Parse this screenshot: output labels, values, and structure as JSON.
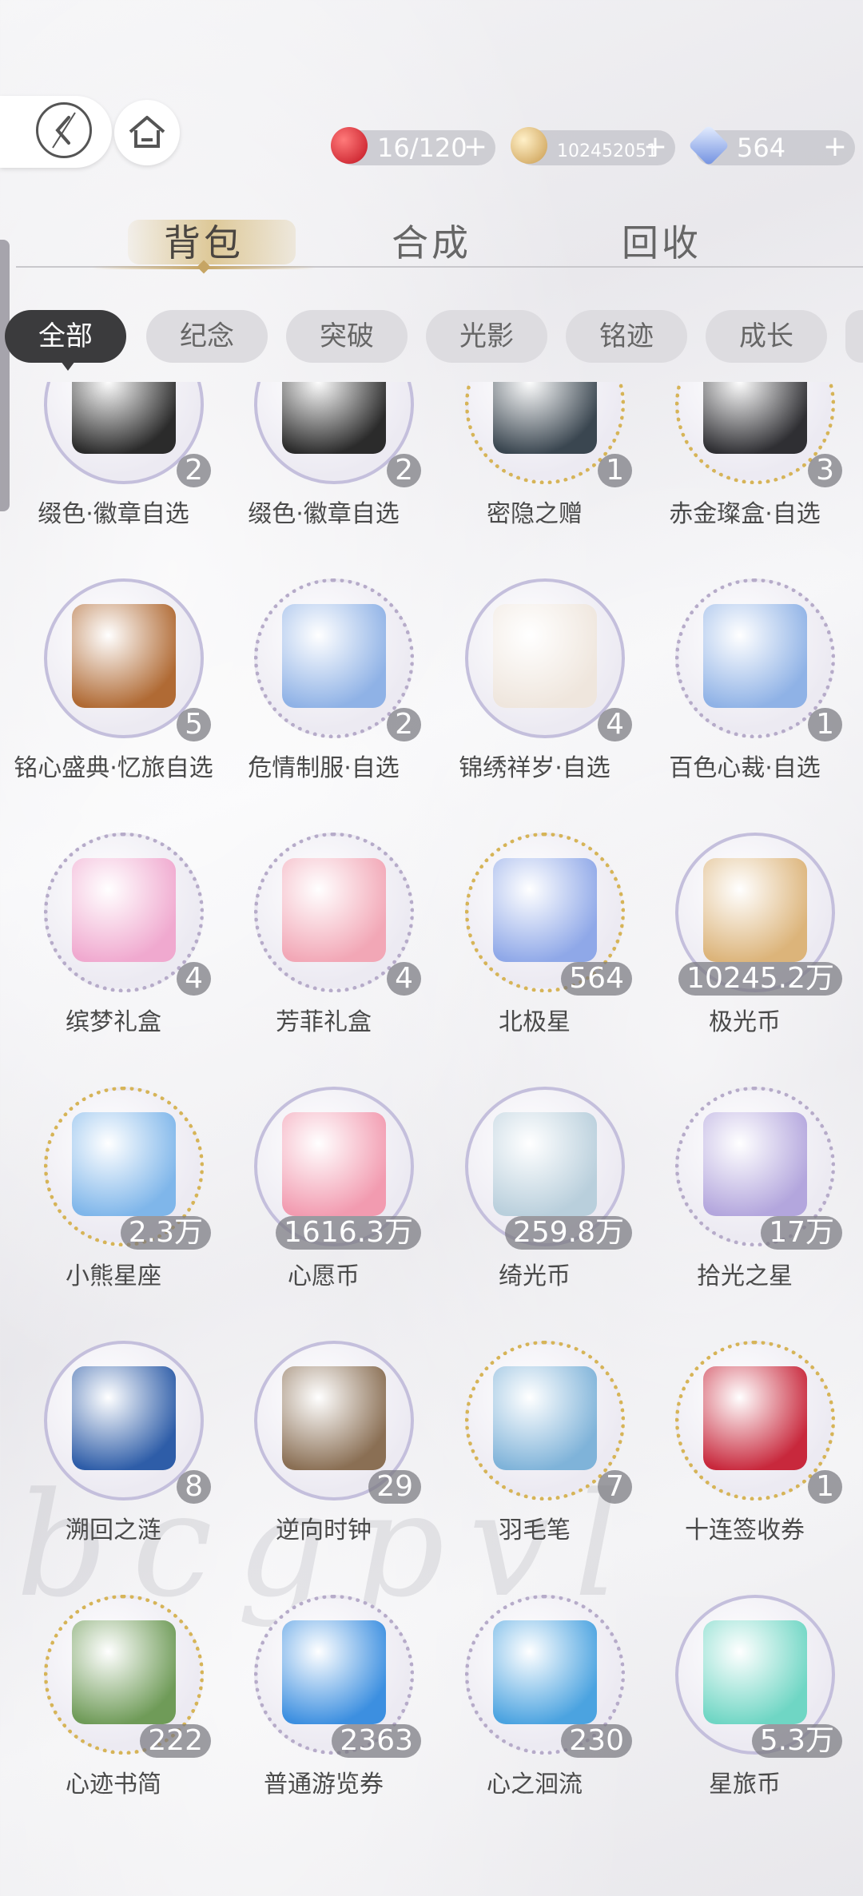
{
  "resources": [
    {
      "icon": "apple-icon",
      "value": "16/120",
      "color": "#d9262b"
    },
    {
      "icon": "coin-icon",
      "value": "102452051",
      "color": "#d8b26a"
    },
    {
      "icon": "star-crystal-icon",
      "value": "564",
      "color": "#7b8fd6"
    }
  ],
  "tabs": [
    "背包",
    "合成",
    "回收"
  ],
  "categories": [
    "全部",
    "纪念",
    "突破",
    "光影",
    "铭迹",
    "成长"
  ],
  "items": [
    {
      "name": "缀色·徽章自选",
      "count": "2",
      "border": "plain",
      "color": "#2b2b2b"
    },
    {
      "name": "缀色·徽章自选",
      "count": "2",
      "border": "plain",
      "color": "#2b2b2b"
    },
    {
      "name": "密隐之赠",
      "count": "1",
      "border": "gold",
      "color": "#3a4650"
    },
    {
      "name": "赤金璨盒·自选",
      "count": "3",
      "border": "gold",
      "color": "#2f2f33"
    },
    {
      "name": "铭心盛典·忆旅自选",
      "count": "5",
      "border": "plain",
      "color": "#b06a34"
    },
    {
      "name": "危情制服·自选",
      "count": "2",
      "border": "glitter",
      "color": "#8fb2e6"
    },
    {
      "name": "锦绣祥岁·自选",
      "count": "4",
      "border": "plain",
      "color": "#efe6dd"
    },
    {
      "name": "百色心裁·自选",
      "count": "1",
      "border": "glitter",
      "color": "#8fb2e6"
    },
    {
      "name": "缤梦礼盒",
      "count": "4",
      "border": "glitter",
      "color": "#f0a9cf"
    },
    {
      "name": "芳菲礼盒",
      "count": "4",
      "border": "glitter",
      "color": "#f2a7b6"
    },
    {
      "name": "北极星",
      "count": "564",
      "border": "gold",
      "color": "#8fa8e8"
    },
    {
      "name": "极光币",
      "count": "10245.2万",
      "border": "plain",
      "color": "#dcb47a"
    },
    {
      "name": "小熊星座",
      "count": "2.3万",
      "border": "gold",
      "color": "#7fb6ea"
    },
    {
      "name": "心愿币",
      "count": "1616.3万",
      "border": "plain",
      "color": "#f29bb0"
    },
    {
      "name": "绮光币",
      "count": "259.8万",
      "border": "plain",
      "color": "#b9cfdc"
    },
    {
      "name": "拾光之星",
      "count": "17万",
      "border": "glitter",
      "color": "#b3a6dd"
    },
    {
      "name": "溯回之涟",
      "count": "8",
      "border": "plain",
      "color": "#2e5da8"
    },
    {
      "name": "逆向时钟",
      "count": "29",
      "border": "plain",
      "color": "#8a6f54"
    },
    {
      "name": "羽毛笔",
      "count": "7",
      "border": "gold",
      "color": "#7fb3d9"
    },
    {
      "name": "十连签收券",
      "count": "1",
      "border": "gold",
      "color": "#c8283c"
    },
    {
      "name": "心迹书简",
      "count": "222",
      "border": "gold",
      "color": "#6f9b58"
    },
    {
      "name": "普通游览券",
      "count": "2363",
      "border": "glitter",
      "color": "#3c8fe0"
    },
    {
      "name": "心之洄流",
      "count": "230",
      "border": "glitter",
      "color": "#4ba3e0"
    },
    {
      "name": "星旅币",
      "count": "5.3万",
      "border": "plain",
      "color": "#6fd6c4"
    }
  ]
}
